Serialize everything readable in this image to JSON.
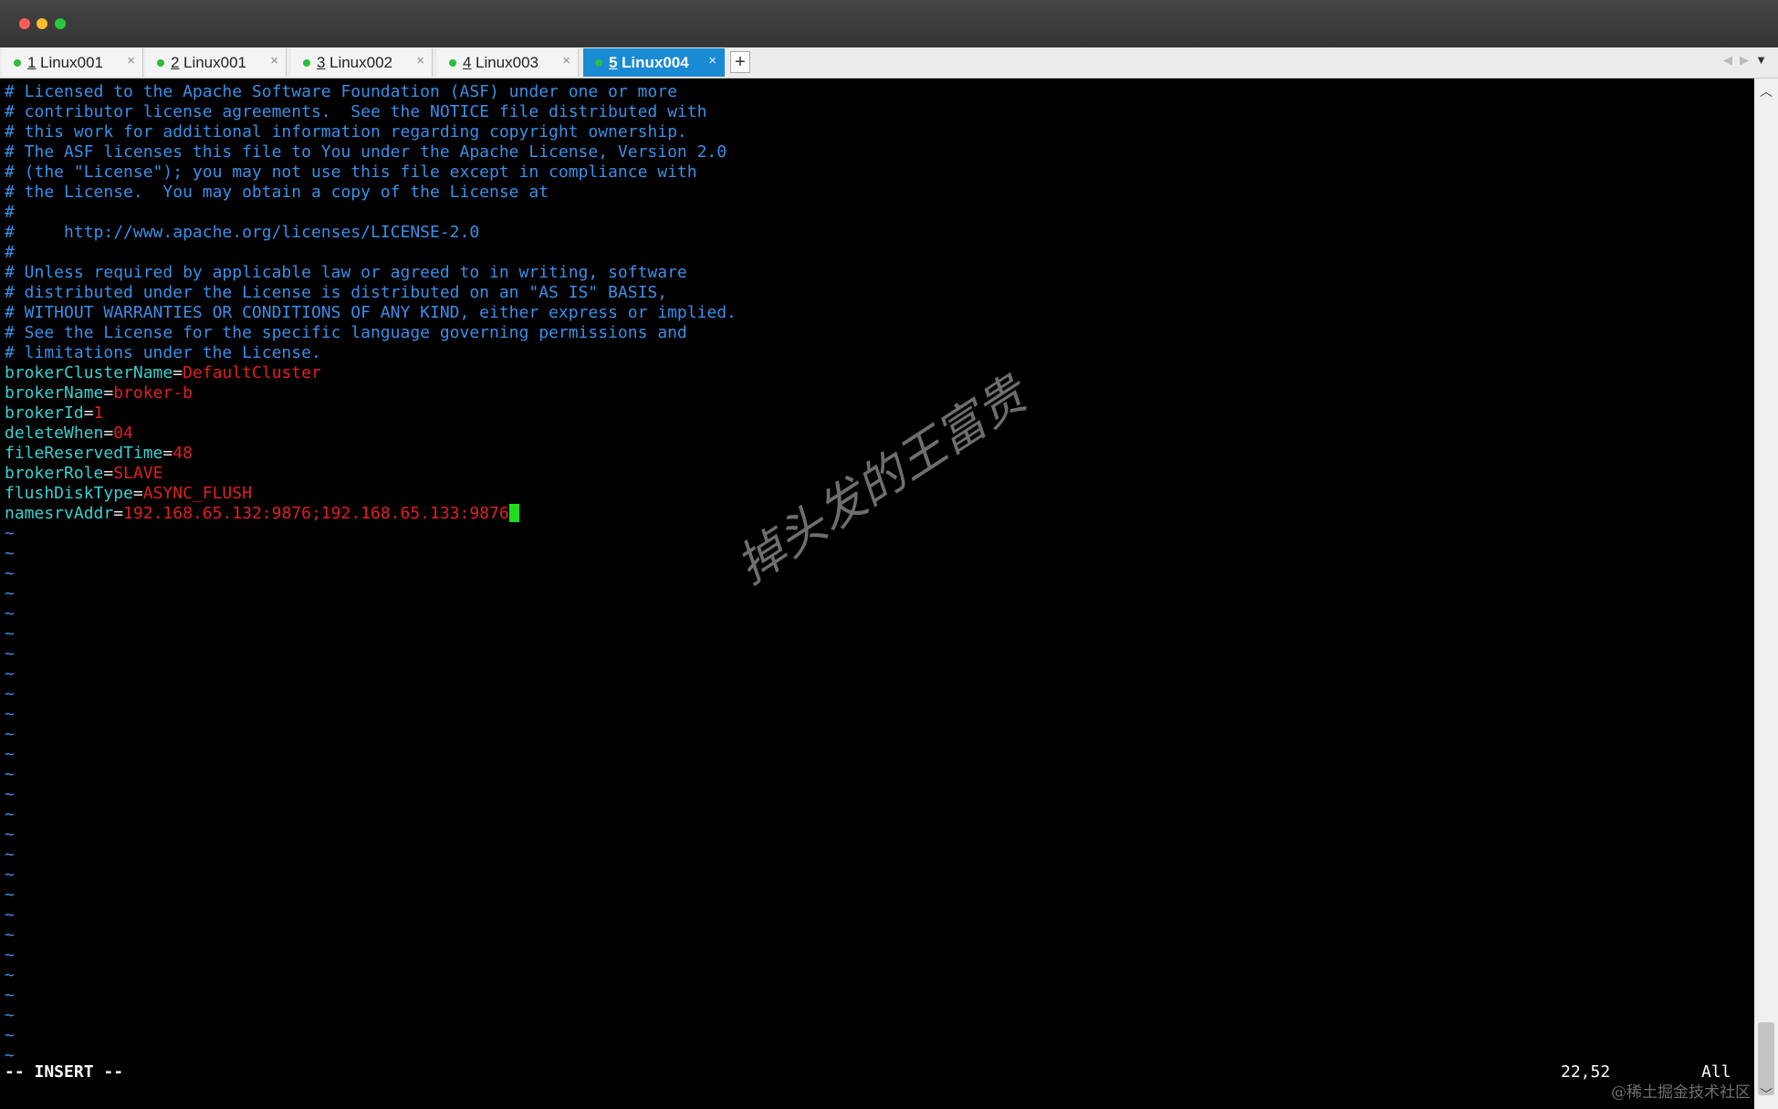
{
  "tabs": [
    {
      "num": "1",
      "name": "Linux001",
      "active": false
    },
    {
      "num": "2",
      "name": "Linux001",
      "active": false
    },
    {
      "num": "3",
      "name": "Linux002",
      "active": false
    },
    {
      "num": "4",
      "name": "Linux003",
      "active": false
    },
    {
      "num": "5",
      "name": "Linux004",
      "active": true
    }
  ],
  "tab_close_glyph": "×",
  "new_tab_glyph": "+",
  "comment_lines": [
    "# Licensed to the Apache Software Foundation (ASF) under one or more",
    "# contributor license agreements.  See the NOTICE file distributed with",
    "# this work for additional information regarding copyright ownership.",
    "# The ASF licenses this file to You under the Apache License, Version 2.0",
    "# (the \"License\"); you may not use this file except in compliance with",
    "# the License.  You may obtain a copy of the License at",
    "#",
    "#     http://www.apache.org/licenses/LICENSE-2.0",
    "#",
    "# Unless required by applicable law or agreed to in writing, software",
    "# distributed under the License is distributed on an \"AS IS\" BASIS,",
    "# WITHOUT WARRANTIES OR CONDITIONS OF ANY KIND, either express or implied.",
    "# See the License for the specific language governing permissions and",
    "# limitations under the License."
  ],
  "config_lines": [
    {
      "key": "brokerClusterName",
      "value": "DefaultCluster"
    },
    {
      "key": "brokerName",
      "value": "broker-b"
    },
    {
      "key": "brokerId",
      "value": "1"
    },
    {
      "key": "deleteWhen",
      "value": "04"
    },
    {
      "key": "fileReservedTime",
      "value": "48"
    },
    {
      "key": "brokerRole",
      "value": "SLAVE"
    },
    {
      "key": "flushDiskType",
      "value": "ASYNC_FLUSH"
    },
    {
      "key": "namesrvAddr",
      "value": "192.168.65.132:9876;192.168.65.133:9876"
    }
  ],
  "tilde_glyph": "~",
  "tilde_count": 27,
  "status": {
    "mode": "-- INSERT --",
    "position": "22,52",
    "scroll": "All"
  },
  "watermark_text": "掉头发的王富贵",
  "corner_watermark": "@稀土掘金技术社区",
  "colors": {
    "comment": "#3a8fe8",
    "key": "#3ad0d0",
    "value": "#e02020",
    "cursor": "#1edc1e",
    "active_tab": "#1a8ad4"
  }
}
